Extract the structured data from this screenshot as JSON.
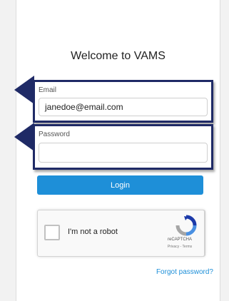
{
  "page": {
    "title": "Welcome to VAMS"
  },
  "email": {
    "label": "Email",
    "value": "janedoe@email.com"
  },
  "password": {
    "label": "Password",
    "value": ""
  },
  "login": {
    "label": "Login"
  },
  "recaptcha": {
    "text": "I'm not a robot",
    "brand": "reCAPTCHA",
    "links": "Privacy - Terms",
    "checked": false,
    "icon": "recaptcha-icon"
  },
  "forgot_password": {
    "label": "Forgot password?"
  },
  "colors": {
    "accent": "#1e8fd8",
    "frame": "#1f2a66"
  }
}
